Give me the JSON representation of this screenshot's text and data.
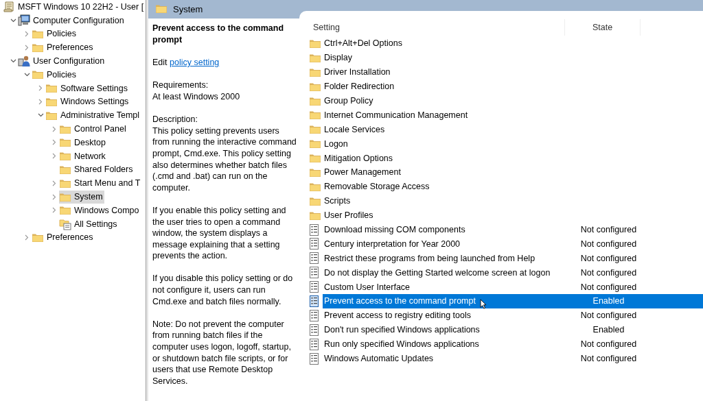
{
  "tree": [
    {
      "label": "MSFT Windows 10 22H2 - User [",
      "kind": "scroll",
      "selected": false,
      "children": [
        {
          "label": "Computer Configuration",
          "kind": "computer",
          "expanded": true,
          "selected": false,
          "children": [
            {
              "label": "Policies",
              "kind": "folder",
              "expanded": false,
              "selected": false
            },
            {
              "label": "Preferences",
              "kind": "folder",
              "expanded": false,
              "selected": false
            }
          ]
        },
        {
          "label": "User Configuration",
          "kind": "user",
          "expanded": true,
          "selected": false,
          "children": [
            {
              "label": "Policies",
              "kind": "folder",
              "expanded": true,
              "selected": false,
              "children": [
                {
                  "label": "Software Settings",
                  "kind": "folder",
                  "expanded": false,
                  "selected": false
                },
                {
                  "label": "Windows Settings",
                  "kind": "folder",
                  "expanded": false,
                  "selected": false
                },
                {
                  "label": "Administrative Templ",
                  "kind": "folder",
                  "expanded": true,
                  "selected": false,
                  "children": [
                    {
                      "label": "Control Panel",
                      "kind": "folder",
                      "expanded": false,
                      "selected": false
                    },
                    {
                      "label": "Desktop",
                      "kind": "folder",
                      "expanded": false,
                      "selected": false
                    },
                    {
                      "label": "Network",
                      "kind": "folder",
                      "expanded": false,
                      "selected": false
                    },
                    {
                      "label": "Shared Folders",
                      "kind": "folder",
                      "selected": false
                    },
                    {
                      "label": "Start Menu and T",
                      "kind": "folder",
                      "expanded": false,
                      "selected": false
                    },
                    {
                      "label": "System",
                      "kind": "folder",
                      "expanded": false,
                      "selected": true
                    },
                    {
                      "label": "Windows Compo",
                      "kind": "folder",
                      "expanded": false,
                      "selected": false
                    },
                    {
                      "label": "All Settings",
                      "kind": "settings",
                      "selected": false
                    }
                  ]
                }
              ]
            },
            {
              "label": "Preferences",
              "kind": "folder",
              "expanded": false,
              "selected": false
            }
          ]
        }
      ]
    }
  ],
  "header": {
    "title": "System"
  },
  "description": {
    "title": "Prevent access to the command prompt",
    "edit_prefix": "Edit",
    "edit_link": "policy setting",
    "requirements_label": "Requirements:",
    "requirements": "At least Windows 2000",
    "description_label": "Description:",
    "paragraphs": [
      "This policy setting prevents users from running the interactive command prompt, Cmd.exe.  This policy setting also determines whether batch files (.cmd and .bat) can run on the computer.",
      "If you enable this policy setting and the user tries to open a command window, the system displays a message explaining that a setting prevents the action.",
      "If you disable this policy setting or do not configure it, users can run Cmd.exe and batch files normally.",
      "Note: Do not prevent the computer from running batch files if the computer uses logon, logoff, startup, or shutdown batch file scripts, or for users that use Remote Desktop Services."
    ]
  },
  "list": {
    "columns": [
      "Setting",
      "State"
    ],
    "rows": [
      {
        "kind": "folder",
        "name": "Ctrl+Alt+Del Options",
        "selected": false
      },
      {
        "kind": "folder",
        "name": "Display",
        "selected": false
      },
      {
        "kind": "folder",
        "name": "Driver Installation",
        "selected": false
      },
      {
        "kind": "folder",
        "name": "Folder Redirection",
        "selected": false
      },
      {
        "kind": "folder",
        "name": "Group Policy",
        "selected": false
      },
      {
        "kind": "folder",
        "name": "Internet Communication Management",
        "selected": false
      },
      {
        "kind": "folder",
        "name": "Locale Services",
        "selected": false
      },
      {
        "kind": "folder",
        "name": "Logon",
        "selected": false
      },
      {
        "kind": "folder",
        "name": "Mitigation Options",
        "selected": false
      },
      {
        "kind": "folder",
        "name": "Power Management",
        "selected": false
      },
      {
        "kind": "folder",
        "name": "Removable Storage Access",
        "selected": false
      },
      {
        "kind": "folder",
        "name": "Scripts",
        "selected": false
      },
      {
        "kind": "folder",
        "name": "User Profiles",
        "selected": false
      },
      {
        "kind": "policy",
        "name": "Download missing COM components",
        "state": "Not configured",
        "selected": false
      },
      {
        "kind": "policy",
        "name": "Century interpretation for Year 2000",
        "state": "Not configured",
        "selected": false
      },
      {
        "kind": "policy",
        "name": "Restrict these programs from being launched from Help",
        "state": "Not configured",
        "selected": false
      },
      {
        "kind": "policy",
        "name": "Do not display the Getting Started welcome screen at logon",
        "state": "Not configured",
        "selected": false
      },
      {
        "kind": "policy",
        "name": "Custom User Interface",
        "state": "Not configured",
        "selected": false
      },
      {
        "kind": "policy",
        "name": "Prevent access to the command prompt",
        "state": "Enabled",
        "selected": true
      },
      {
        "kind": "policy",
        "name": "Prevent access to registry editing tools",
        "state": "Not configured",
        "selected": false
      },
      {
        "kind": "policy",
        "name": "Don't run specified Windows applications",
        "state": "Enabled",
        "selected": false
      },
      {
        "kind": "policy",
        "name": "Run only specified Windows applications",
        "state": "Not configured",
        "selected": false
      },
      {
        "kind": "policy",
        "name": "Windows Automatic Updates",
        "state": "Not configured",
        "selected": false
      }
    ]
  }
}
